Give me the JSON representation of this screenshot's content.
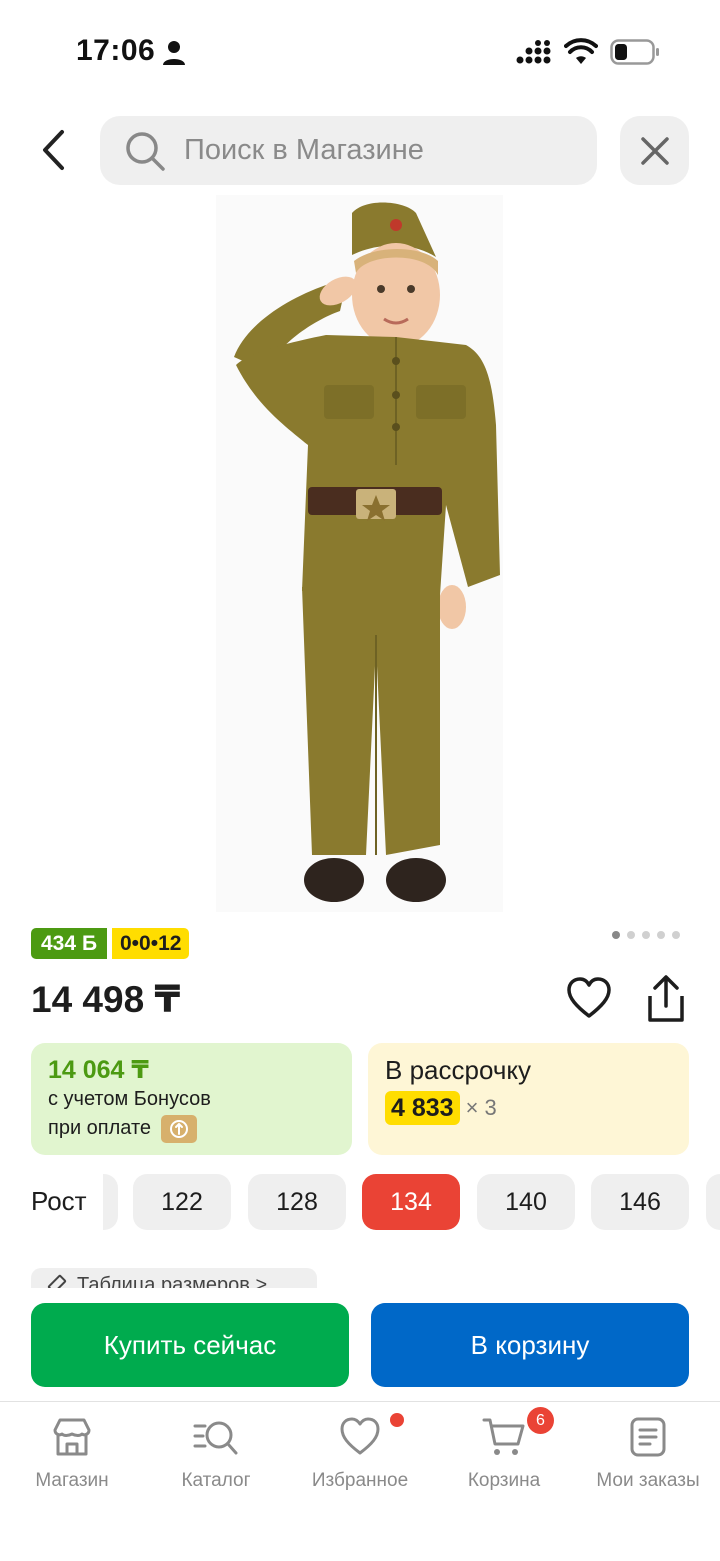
{
  "status_bar": {
    "time": "17:06"
  },
  "search": {
    "placeholder": "Поиск в Магазине"
  },
  "product": {
    "image_alt": "Детский костюм солдата",
    "bonus_badge": "434",
    "bonus_symbol": "Б",
    "installment_badge": "0•0•12",
    "price": "14 498 ₸",
    "image_pages": 5,
    "image_page_active": 1
  },
  "bonus_card": {
    "amount": "14 064 ₸",
    "line1": "с учетом Бонусов",
    "line2": "при оплате"
  },
  "installment_card": {
    "title": "В рассрочку",
    "amount": "4 833",
    "multiplier": "× 3"
  },
  "sizes": {
    "label": "Рост",
    "options": [
      "122",
      "128",
      "134",
      "140",
      "146"
    ],
    "selected": "134"
  },
  "size_table_link": "Таблица размеров >",
  "actions": {
    "buy_now": "Купить сейчас",
    "add_to_cart": "В корзину"
  },
  "tab_bar": {
    "items": [
      {
        "label": "Магазин",
        "icon": "store-icon"
      },
      {
        "label": "Каталог",
        "icon": "catalog-search-icon"
      },
      {
        "label": "Избранное",
        "icon": "heart-icon"
      },
      {
        "label": "Корзина",
        "icon": "cart-icon"
      },
      {
        "label": "Мои заказы",
        "icon": "orders-list-icon"
      }
    ],
    "cart_count": "6"
  },
  "colors": {
    "accent_green": "#00ab4e",
    "accent_blue": "#0068c8",
    "selected_red": "#ea4335",
    "bonus_green": "#4c9a12",
    "installment_yellow": "#ffdd00"
  }
}
